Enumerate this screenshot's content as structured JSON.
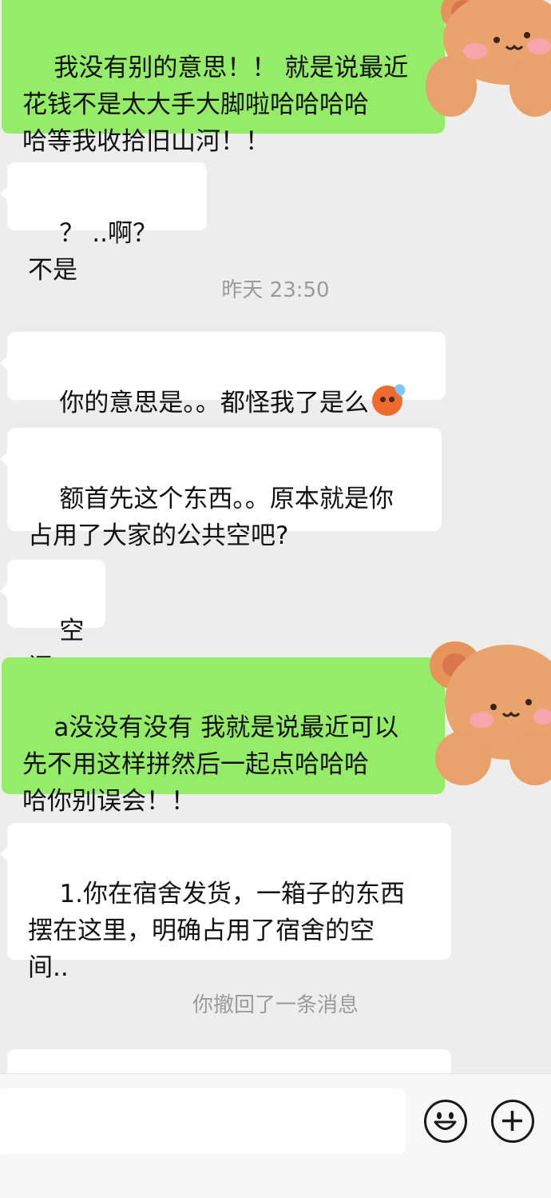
{
  "messages": [
    {
      "type": "out",
      "text": "我没有别的意思！！ 就是说最近\n花钱不是太大手大脚啦哈哈哈哈\n哈等我收拾旧山河！！"
    },
    {
      "type": "in",
      "text": "？ ..啊？ 不是"
    },
    {
      "type": "system",
      "text": "昨天 23:50"
    },
    {
      "type": "in",
      "text": "你的意思是。。都怪我了是么",
      "emoji": "sweat-pouting-face"
    },
    {
      "type": "in",
      "text": "额首先这个东西。。原本就是你\n占用了大家的公共空吧?"
    },
    {
      "type": "in",
      "text": "空间"
    },
    {
      "type": "out",
      "text": "a没没有没有 我就是说最近可以\n先不用这样拼然后一起点哈哈哈\n哈你别误会！！"
    },
    {
      "type": "in",
      "text": "1.你在宿舍发货，一箱子的东西\n摆在这里，明确占用了宿舍的空\n间.."
    },
    {
      "type": "system",
      "text": "你撤回了一条消息"
    }
  ],
  "bottom_bar": {
    "input_value": "",
    "emoji_button": "smiley-face-icon",
    "more_button": "plus-circle-icon"
  },
  "colors": {
    "background": "#ededed",
    "incoming_bubble": "#ffffff",
    "outgoing_bubble": "#95ec69",
    "system_text": "#9b9b9b",
    "bear": "#e9a06b"
  }
}
